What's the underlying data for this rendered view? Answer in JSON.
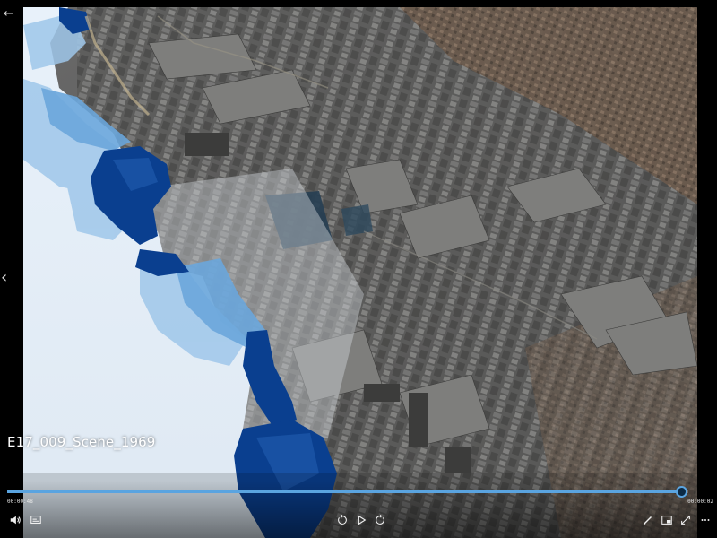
{
  "video": {
    "title": "E17_009_Scene_1969",
    "elapsed": "00:00:48",
    "remaining": "00:00:02",
    "progress": 0.99
  },
  "icons": {
    "back": "back-arrow-icon",
    "previous": "chevron-left-icon",
    "volume": "volume-icon",
    "captions": "captions-icon",
    "skip_back": "skip-back-10-icon",
    "play": "play-icon",
    "skip_forward": "skip-forward-30-icon",
    "edit": "pen-icon",
    "miniview": "mini-view-icon",
    "fullscreen": "fullscreen-icon",
    "more": "more-options-icon"
  },
  "colors": {
    "accent": "#5aa4e0",
    "flood_deep": "#0a3f8f",
    "flood_light": "#cfe4f6"
  }
}
